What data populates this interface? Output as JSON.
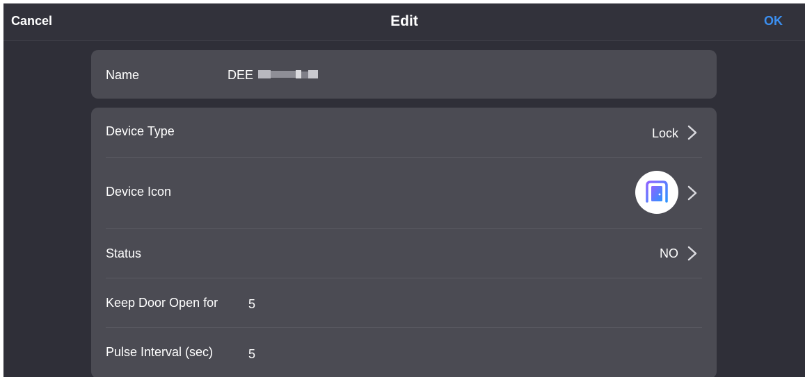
{
  "topbar": {
    "cancel_label": "Cancel",
    "title": "Edit",
    "ok_label": "OK"
  },
  "name_card": {
    "label": "Name",
    "value_visible": "DEE"
  },
  "settings": {
    "device_type": {
      "label": "Device Type",
      "value": "Lock"
    },
    "device_icon": {
      "label": "Device Icon",
      "icon": "door-icon"
    },
    "status": {
      "label": "Status",
      "value": "NO"
    },
    "keep_door_open": {
      "label": "Keep Door Open for",
      "value": "5"
    },
    "pulse_interval": {
      "label": "Pulse Interval (sec)",
      "value": "5"
    }
  },
  "colors": {
    "background": "#2f2f38",
    "card": "#4b4b53",
    "accent": "#3b8ff0",
    "text": "#ffffff"
  }
}
